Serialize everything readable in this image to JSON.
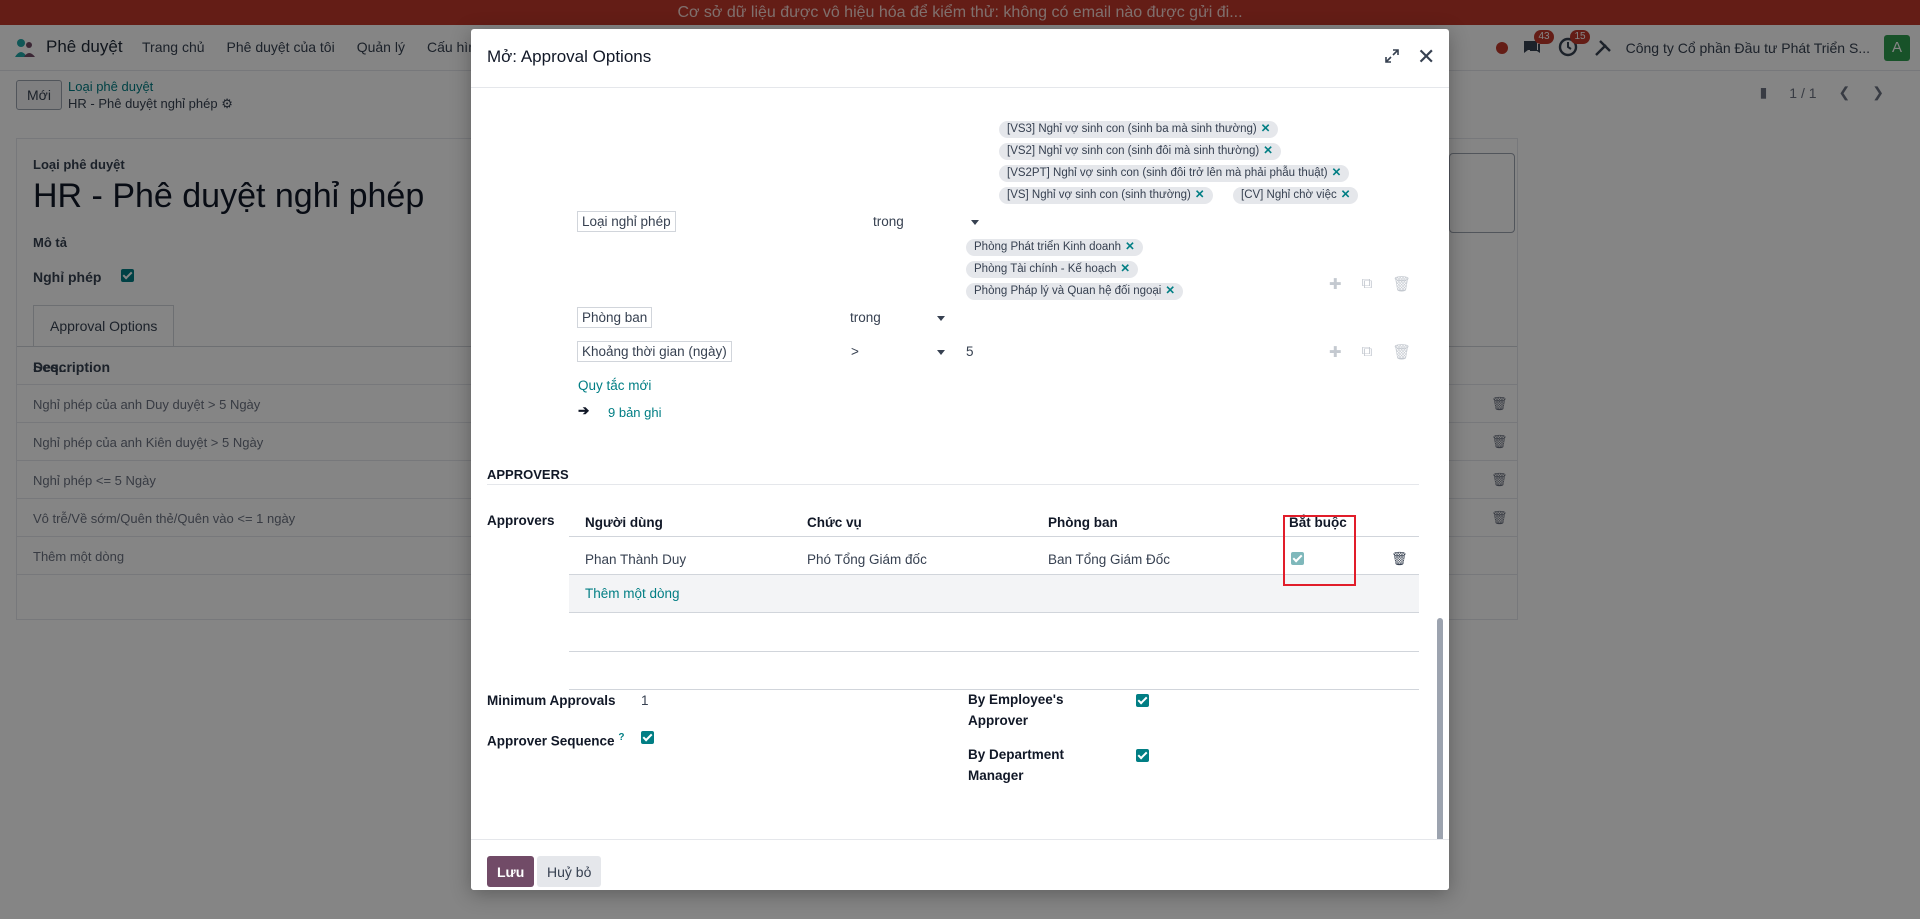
{
  "banner": {
    "text": "Cơ sở dữ liệu được vô hiệu hóa để kiểm thử: không có email nào được gửi đi..."
  },
  "topnav": {
    "app_name": "Phê duyệt",
    "menu": [
      "Trang chủ",
      "Phê duyệt của tôi",
      "Quản lý",
      "Cấu hìn"
    ],
    "messages_count": "43",
    "activities_count": "15",
    "company": "Công ty Cổ phần Đầu tư Phát Triển S...",
    "avatar_letter": "A"
  },
  "control_panel": {
    "new_button": "Mới",
    "breadcrumb_parent": "Loại phê duyệt",
    "breadcrumb_current": "HR - Phê duyệt nghỉ phép",
    "pager": "1 / 1"
  },
  "bg_form": {
    "type_label": "Loại phê duyệt",
    "title": "HR - Phê duyệt nghỉ phép",
    "description_label": "Mô tả",
    "leave_label": "Nghỉ phép",
    "tab_label": "Approval Options",
    "column_description": "Description",
    "column_seq": "Seq...",
    "rows": [
      "Nghỉ phép của anh Duy duyệt > 5 Ngày",
      "Nghỉ phép của anh Kiên duyệt > 5 Ngày",
      "Nghỉ phép <= 5 Ngày",
      "Vô trễ/Về sớm/Quên thẻ/Quên vào <= 1 ngày"
    ],
    "add_line": "Thêm một dòng"
  },
  "modal": {
    "title": "Mở: Approval Options",
    "tags_leave_type": [
      "[VS3] Nghỉ vợ sinh con (sinh ba mà sinh thường)",
      "[VS2] Nghỉ vợ sinh con (sinh đôi mà sinh thường)",
      "[VS2PT] Nghỉ vợ sinh con (sinh đôi trở lên mà phải phẫu thuật)",
      "[VS] Nghỉ vợ sinh con (sinh thường)",
      "[CV] Nghỉ chờ việc"
    ],
    "rule_leave_type": {
      "field": "Loại nghỉ phép",
      "operator": "trong"
    },
    "tags_department": [
      "Phòng Phát triển Kinh doanh",
      "Phòng Tài chính - Kế hoạch",
      "Phòng Pháp lý và Quan hệ đối ngoại"
    ],
    "rule_department": {
      "field": "Phòng ban",
      "operator": "trong"
    },
    "rule_duration": {
      "field": "Khoảng thời gian (ngày)",
      "operator": ">",
      "value": "5"
    },
    "new_rule": "Quy tắc mới",
    "records_link": "9 bản ghi",
    "approvers_section": "APPROVERS",
    "approvers_label": "Approvers",
    "approvers_columns": {
      "user": "Người dùng",
      "position": "Chức vụ",
      "department": "Phòng ban",
      "required": "Bắt buộc"
    },
    "approvers_rows": [
      {
        "user": "Phan Thành Duy",
        "position": "Phó Tổng Giám đốc",
        "department": "Ban Tổng Giám Đốc",
        "required": true
      }
    ],
    "add_line": "Thêm một dòng",
    "minimum_approvals_label": "Minimum Approvals",
    "minimum_approvals_value": "1",
    "approver_sequence_label": "Approver Sequence",
    "approver_sequence_help": "?",
    "by_employee_approver_label_1": "By Employee's",
    "by_employee_approver_label_2": "Approver",
    "by_department_manager_label_1": "By Department",
    "by_department_manager_label_2": "Manager",
    "save_button": "Lưu",
    "cancel_button": "Huỷ bỏ"
  },
  "colors": {
    "primary": "#714b67",
    "accent": "#017e84",
    "banner": "#c0392b",
    "highlight": "#e11d2a"
  }
}
